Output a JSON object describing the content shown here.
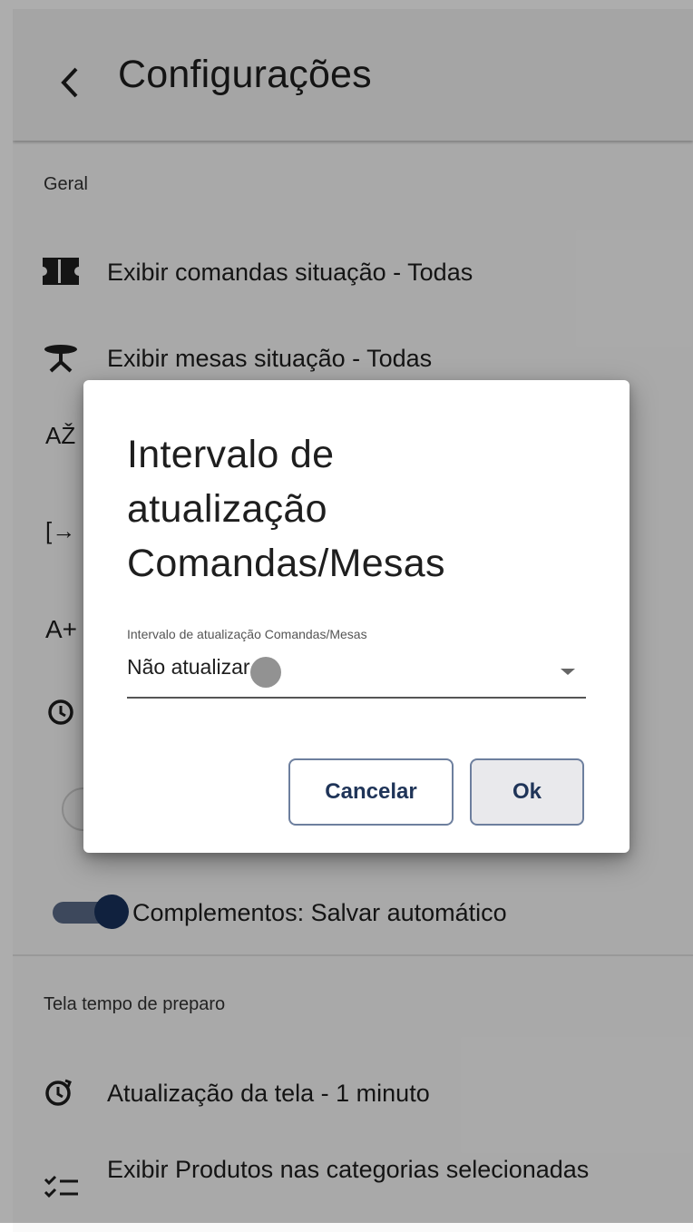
{
  "header": {
    "title": "Configurações"
  },
  "sections": {
    "general": "Geral",
    "prep_screen": "Tela tempo de preparo"
  },
  "items": {
    "comandas": "Exibir comandas situação - Todas",
    "mesas": "Exibir mesas situação - Todas",
    "complementos": "Complementos: Salvar automático",
    "atualizacao_tela": "Atualização da tela - 1 minuto",
    "exibir_produtos": "Exibir Produtos nas categorias selecionadas"
  },
  "partial_icons": {
    "sort": "AŽ",
    "exit": "[→",
    "font": "A+"
  },
  "toggle": {
    "complementos_on": true
  },
  "dialog": {
    "title": "Intervalo de atualização Comandas/Mesas",
    "field_label": "Intervalo de atualização Comandas/Mesas",
    "field_value": "Não atualizar",
    "cancel_label": "Cancelar",
    "ok_label": "Ok"
  },
  "colors": {
    "accent": "#18315c",
    "button_border": "#6d7f9e",
    "button_text": "#1f3458"
  },
  "icons": [
    "back-arrow-icon",
    "ticket-icon",
    "table-icon",
    "sort-az-icon",
    "exit-icon",
    "font-size-icon",
    "refresh-clock-icon",
    "checklist-icon",
    "dropdown-arrow-icon"
  ]
}
